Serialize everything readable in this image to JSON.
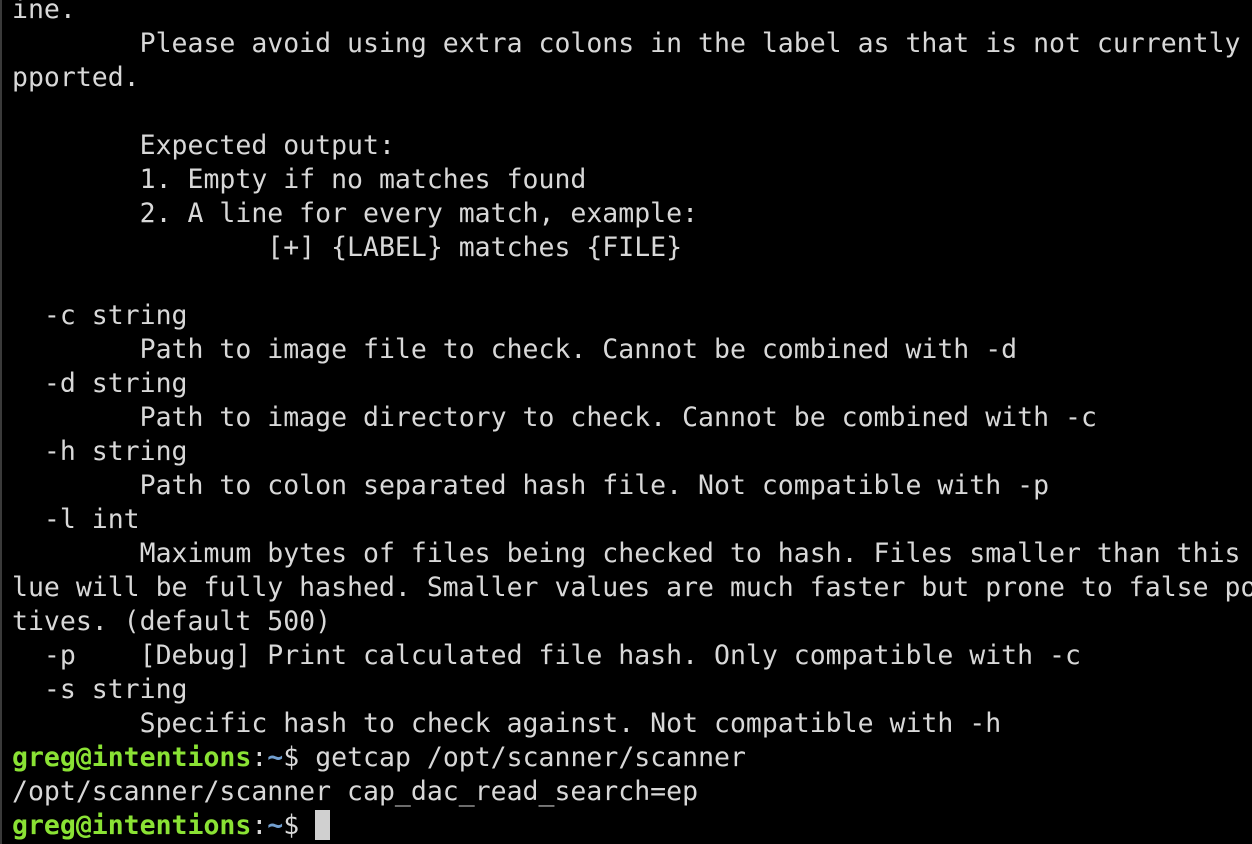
{
  "terminal": {
    "output_lines": [
      "ine.",
      "        Please avoid using extra colons in the label as that is not currently su",
      "pported.",
      "",
      "        Expected output:",
      "        1. Empty if no matches found",
      "        2. A line for every match, example:",
      "                [+] {LABEL} matches {FILE}",
      "",
      "  -c string",
      "        Path to image file to check. Cannot be combined with -d",
      "  -d string",
      "        Path to image directory to check. Cannot be combined with -c",
      "  -h string",
      "        Path to colon separated hash file. Not compatible with -p",
      "  -l int",
      "        Maximum bytes of files being checked to hash. Files smaller than this va",
      "lue will be fully hashed. Smaller values are much faster but prone to false posi",
      "tives. (default 500)",
      "  -p    [Debug] Print calculated file hash. Only compatible with -c",
      "  -s string",
      "        Specific hash to check against. Not compatible with -h"
    ],
    "prompt1": {
      "user_host": "greg@intentions",
      "separator": ":",
      "path": "~",
      "dollar": "$ ",
      "command": "getcap /opt/scanner/scanner"
    },
    "command_output": "/opt/scanner/scanner cap_dac_read_search=ep",
    "prompt2": {
      "user_host": "greg@intentions",
      "separator": ":",
      "path": "~",
      "dollar": "$ ",
      "command": ""
    },
    "colors": {
      "background": "#000000",
      "foreground": "#d8d8d8",
      "user_host": "#8ae234",
      "path": "#729fcf"
    }
  }
}
